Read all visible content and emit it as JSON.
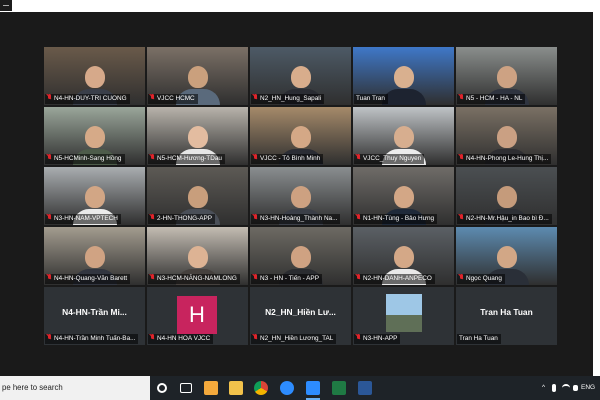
{
  "colors": {
    "active_border": "#b7e23c",
    "muted_mic": "#e0242b",
    "avatar_bg": "#c8245e"
  },
  "grid": {
    "rows": [
      [
        {
          "label": "N4-HN-DUY-TRI CUONG",
          "muted": true,
          "bg": "#6a5a4a",
          "skin": "#d6a98a",
          "shirt": "#3a3f4a"
        },
        {
          "label": "VJCC HCMC",
          "muted": true,
          "bg": "#7b7066",
          "skin": "#caa07d",
          "shirt": "#5a6a7c"
        },
        {
          "label": "N2_HN_Hung_Sapali",
          "muted": true,
          "bg": "#4d5a66",
          "skin": "#d8ad8c",
          "shirt": "#2a2c33"
        },
        {
          "label": "Tuan Tran",
          "muted": false,
          "active": true,
          "bg": "#3f78c8",
          "skin": "#d9b08f",
          "shirt": "#1d2330"
        },
        {
          "label": "N5 - HCM - HA - NL",
          "muted": true,
          "bg": "#8a8e8c",
          "skin": "#cda283",
          "shirt": "#2f3440"
        }
      ],
      [
        {
          "label": "N5-HCMinh-Sang Hồng",
          "muted": true,
          "bg": "#9aa69a",
          "skin": "#d6aa88",
          "shirt": "#4d5c4a"
        },
        {
          "label": "N5-HCM-Hương-TDau",
          "muted": true,
          "bg": "#b8b3ab",
          "skin": "#e3bca0",
          "shirt": "#e6e6e6"
        },
        {
          "label": "VJCC - Tô Bình Minh",
          "muted": true,
          "bg": "#a58a6a",
          "skin": "#d4a886",
          "shirt": "#2b2d35"
        },
        {
          "label": "VJCC_Thuy Nguyen",
          "muted": true,
          "bg": "#bfc3c6",
          "skin": "#d7ae8f",
          "shirt": "#ececec"
        },
        {
          "label": "N4-HN-Phong Le-Hung Thị...",
          "muted": true,
          "bg": "#7a7064",
          "skin": "#caa083",
          "shirt": "#2e2e32"
        }
      ],
      [
        {
          "label": "N3-HN-NAM-VPTECH",
          "muted": true,
          "bg": "#a9adb0",
          "skin": "#d2a685",
          "shirt": "#eaeaea"
        },
        {
          "label": "2-HN-THONG-APP",
          "muted": true,
          "bg": "#5d5a55",
          "skin": "#c89e7c",
          "shirt": "#4a4f58"
        },
        {
          "label": "N3-HN-Hoàng_Thành Na...",
          "muted": true,
          "bg": "#8a8e90",
          "skin": "#cda181",
          "shirt": "#3b3f48"
        },
        {
          "label": "N1-HN-Tùng - Bảo Hưng",
          "muted": true,
          "bg": "#6f6c68",
          "skin": "#d3a786",
          "shirt": "#1f2a3a"
        },
        {
          "label": "N2-HN-Mr.Hậu_in Bao bì Đ...",
          "muted": true,
          "bg": "#4b4f52",
          "skin": "#c59b7b",
          "shirt": "#2d3036"
        }
      ],
      [
        {
          "label": "N4-HN-Quang-Văn Barett",
          "muted": true,
          "bg": "#a39c8f",
          "skin": "#d0a383",
          "shirt": "#323640"
        },
        {
          "label": "N3-HCM-NĂNG-NAMLONG",
          "muted": true,
          "bg": "#c3bcb2",
          "skin": "#ddb394",
          "shirt": "#46413e"
        },
        {
          "label": "N3 - HN - Tiến - APP",
          "muted": true,
          "bg": "#6d6a63",
          "skin": "#cfa282",
          "shirt": "#2a2c30"
        },
        {
          "label": "N2-HN-DANH-ANPECO",
          "muted": true,
          "bg": "#5b6065",
          "skin": "#d4a887",
          "shirt": "#e9e9e9"
        },
        {
          "label": "Ngọc Quang",
          "muted": true,
          "bg": "#5d8bb0",
          "skin": "#d2a786",
          "shirt": "#2a2f38"
        }
      ],
      [
        {
          "label": "N4-HN-Trần Minh Tuấn-Ba...",
          "muted": true,
          "name_only": "N4-HN-Trần   Mi..."
        },
        {
          "label": "N4-HN HOA VJCC",
          "muted": true,
          "avatar_letter": "H"
        },
        {
          "label": "N2_HN_Hiền Lương_TAL",
          "muted": true,
          "name_only": "N2_HN_Hiền   Lư..."
        },
        {
          "label": "N3-HN-APP",
          "muted": true,
          "photo": true
        },
        {
          "label": "Tran Ha Tuan",
          "muted": false,
          "name_only": "Tran Ha Tuan"
        }
      ]
    ]
  },
  "taskbar": {
    "search_text": "pe here to search",
    "tray_lang": "ENG",
    "tray_up": "^"
  }
}
